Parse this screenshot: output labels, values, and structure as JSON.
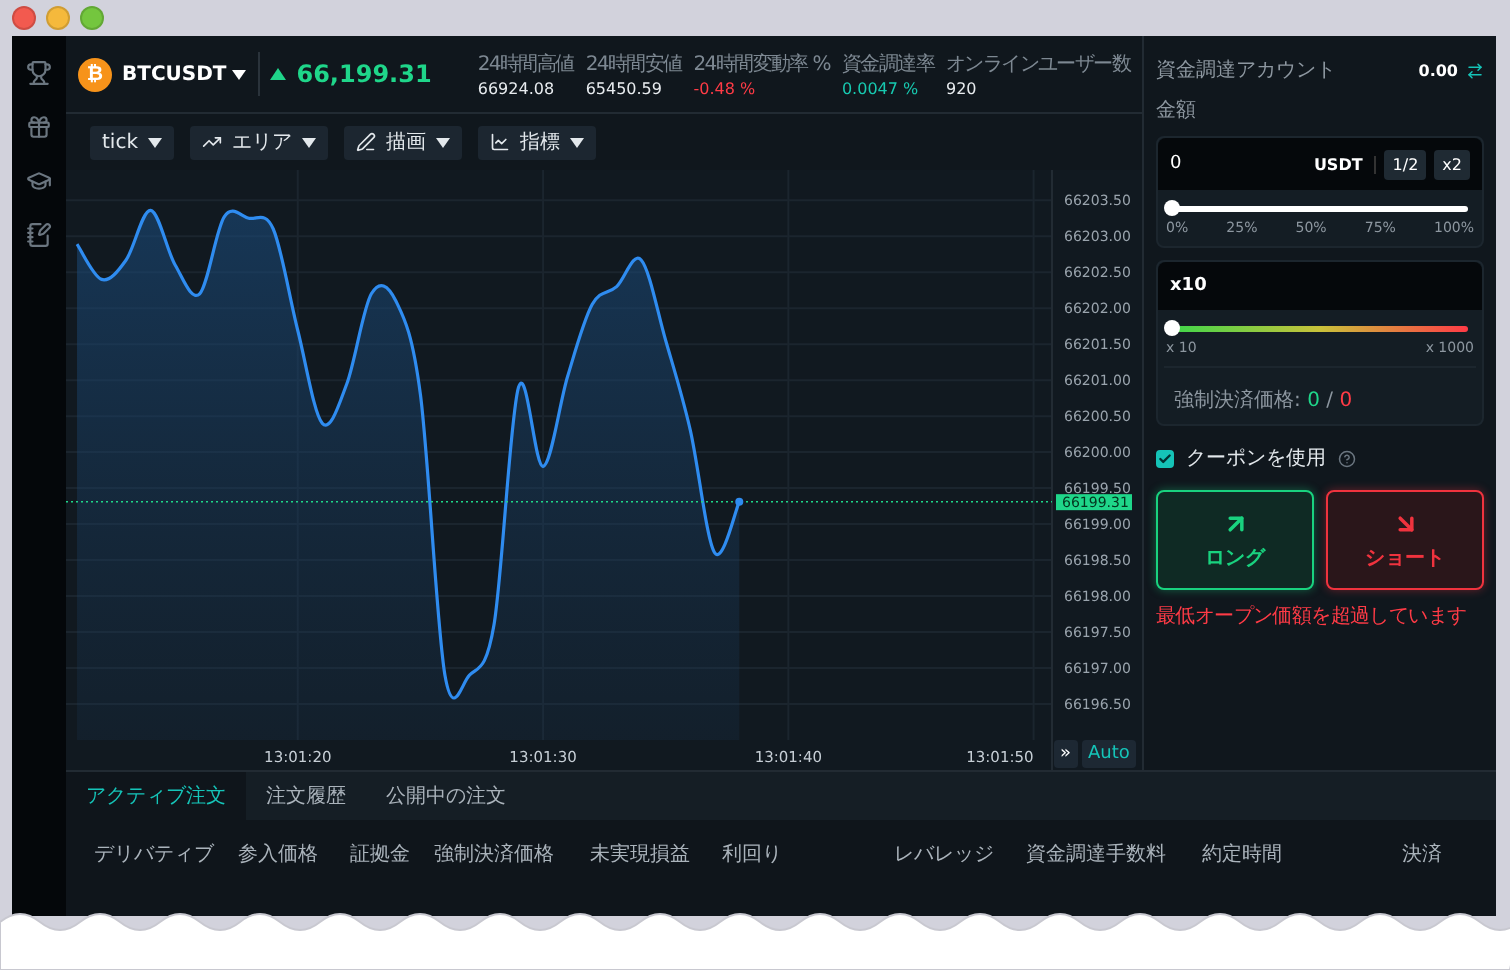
{
  "sidebar": {
    "items": [
      {
        "kind": "trophy"
      },
      {
        "kind": "gift"
      },
      {
        "kind": "cap"
      },
      {
        "kind": "notes"
      }
    ]
  },
  "header": {
    "coin_symbol": "₿",
    "pair": "BTCUSDT",
    "price": "66,199.31",
    "stats": [
      {
        "label": "24時間高値",
        "value": "66924.08",
        "color": "#e8ecef"
      },
      {
        "label": "24時間安値",
        "value": "65450.59",
        "color": "#e8ecef"
      },
      {
        "label": "24時間変動率 %",
        "value": "-0.48 %",
        "color": "#ff3b46"
      },
      {
        "label": "資金調達率",
        "value": "0.0047 %",
        "color": "#17c9b0"
      },
      {
        "label": "オンラインユーザー数",
        "value": "920",
        "color": "#e8ecef"
      }
    ]
  },
  "toolbar": [
    {
      "kind": "plain",
      "label": "tick"
    },
    {
      "kind": "line",
      "label": "エリア"
    },
    {
      "kind": "pen",
      "label": "描画"
    },
    {
      "kind": "chart",
      "label": "指標"
    }
  ],
  "chart": {
    "skip_button": "»",
    "auto_button": "Auto",
    "chart_data": {
      "type": "area",
      "categories": [
        null,
        null,
        null,
        null,
        null,
        null,
        null,
        null,
        null,
        "13:01:20",
        null,
        null,
        null,
        null,
        null,
        null,
        null,
        null,
        null,
        "13:01:30",
        null,
        null,
        null,
        null,
        null,
        null,
        null,
        null,
        null,
        "13:01:40",
        null,
        null,
        null,
        null,
        null,
        null,
        null,
        null,
        null,
        "13:01:50",
        null
      ],
      "series": [
        {
          "color": "#2f8cf0",
          "values": [
            66202.89,
            66202.4,
            66202.67,
            66203.36,
            66202.6,
            66202.2,
            66203.27,
            66203.25,
            66203.1,
            66201.69,
            66200.4,
            66200.95,
            66202.2,
            66202.1,
            66200.8,
            66196.9,
            66196.9,
            66197.6,
            66200.9,
            66199.8,
            66201.05,
            66202.05,
            66202.3,
            66202.67,
            66201.55,
            66200.31,
            66198.6,
            66199.31,
            null,
            null,
            null,
            null,
            null,
            null,
            null,
            null,
            null,
            null,
            null,
            null,
            null
          ]
        }
      ],
      "ylim": [
        66196.0,
        66203.92
      ],
      "grid": true,
      "ref_lines": [
        {
          "axis": "y",
          "value": 66199.31,
          "label": "66199.31",
          "color": "#1fd68a"
        }
      ],
      "yticks": [
        {
          "value": 66203.5,
          "label": "66203.50"
        },
        {
          "value": 66203,
          "label": "66203.00"
        },
        {
          "value": 66202.5,
          "label": "66202.50"
        },
        {
          "value": 66202,
          "label": "66202.00"
        },
        {
          "value": 66201.5,
          "label": "66201.50"
        },
        {
          "value": 66201,
          "label": "66201.00"
        },
        {
          "value": 66200.5,
          "label": "66200.50"
        },
        {
          "value": 66200,
          "label": "66200.00"
        },
        {
          "value": 66199.5,
          "label": "66199.50"
        },
        {
          "value": 66199,
          "label": "66199.00"
        },
        {
          "value": 66198.5,
          "label": "66198.50"
        },
        {
          "value": 66198,
          "label": "66198.00"
        },
        {
          "value": 66197.5,
          "label": "66197.50"
        },
        {
          "value": 66197,
          "label": "66197.00"
        },
        {
          "value": 66196.5,
          "label": "66196.50"
        }
      ]
    }
  },
  "order_panel": {
    "account_label": "資金調達アカウント",
    "account_value": "0.00",
    "amount_label": "金額",
    "amount": {
      "value": "0",
      "unit": "USDT",
      "buttons": [
        "1/2",
        "x2"
      ]
    },
    "amount_slider": {
      "level": 0,
      "marks": [
        "0%",
        "25%",
        "50%",
        "75%",
        "100%"
      ]
    },
    "leverage": {
      "value": "x10",
      "level": 0,
      "min": "x 10",
      "max": "x 1000"
    },
    "liquidation": {
      "label": "強制決済価格:",
      "long": "0",
      "separator": "/",
      "short": "0"
    },
    "coupon": {
      "label": "クーポンを使用",
      "checked": true
    },
    "long_button": "ロング",
    "short_button": "ショート",
    "error": "最低オープン価額を超過しています"
  },
  "orders": {
    "tabs": [
      {
        "label": "アクティブ注文",
        "selected": true
      },
      {
        "label": "注文履歴",
        "selected": false
      },
      {
        "label": "公開中の注文",
        "selected": false
      }
    ],
    "columns": [
      "デリバティブ",
      "参入価格",
      "証拠金",
      "強制決済価格",
      "未実現損益",
      "利回り",
      "レバレッジ",
      "資金調達手数料",
      "約定時間",
      "決済"
    ]
  }
}
